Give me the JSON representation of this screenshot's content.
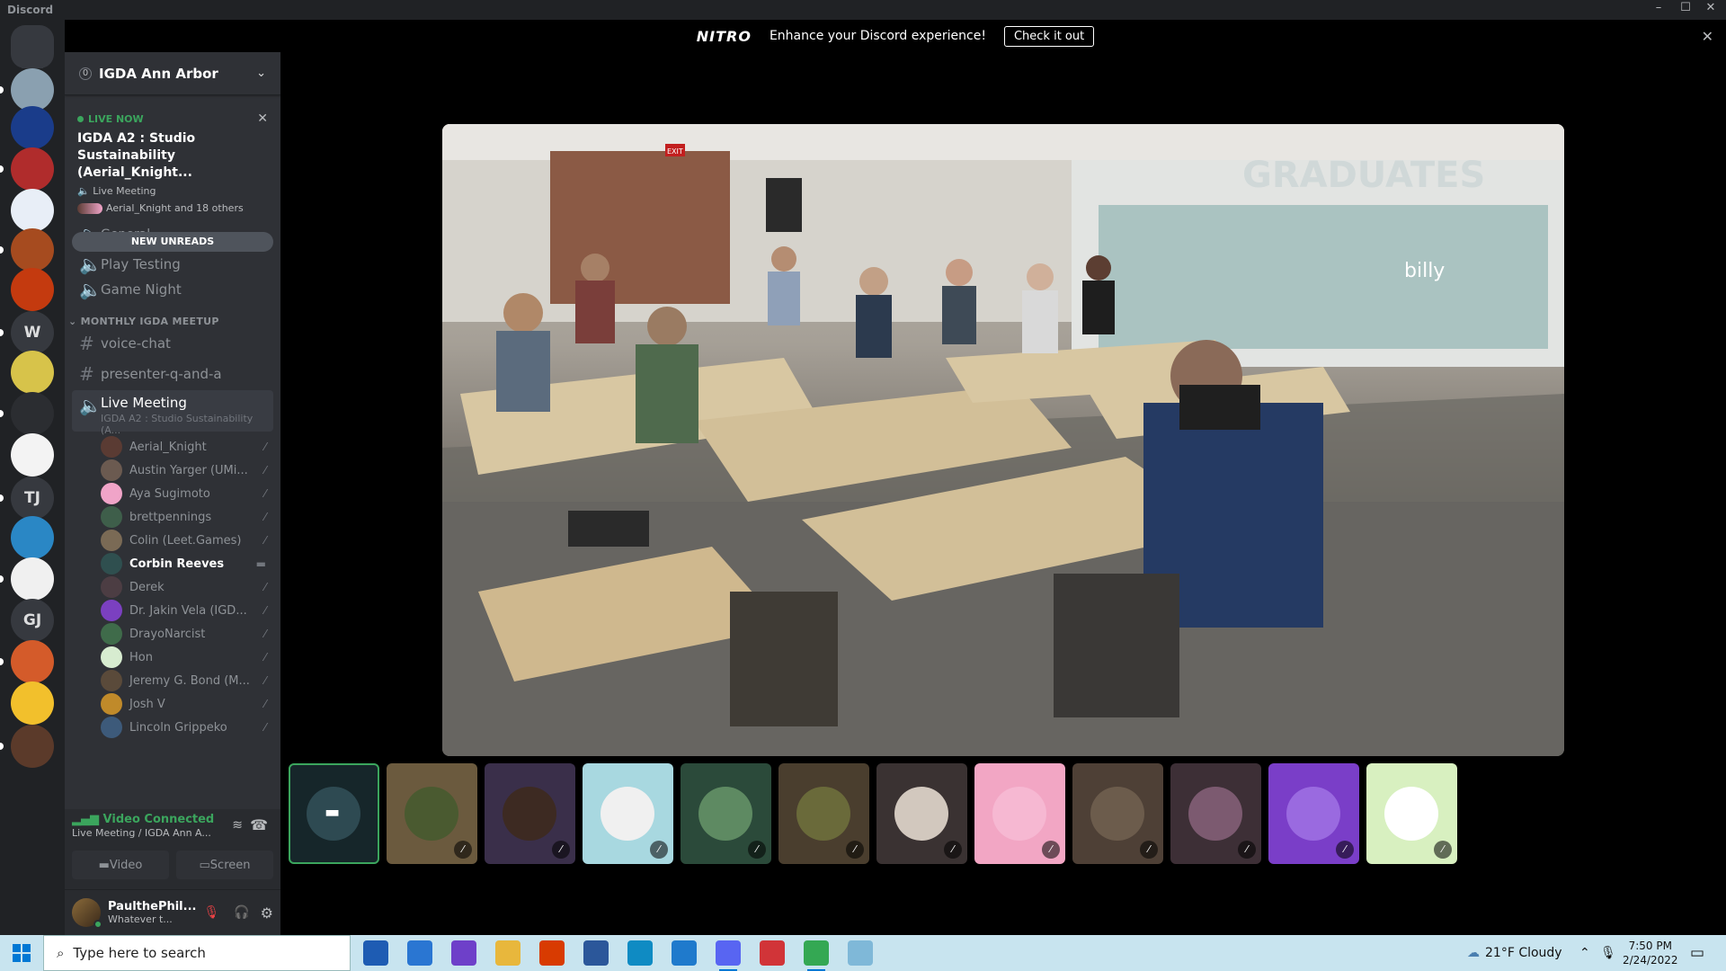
{
  "window": {
    "title": "Discord",
    "minimize": "–",
    "maximize": "☐",
    "close": "✕"
  },
  "nitro": {
    "logo": "NITRO",
    "message": "Enhance your Discord experience!",
    "cta": "Check it out",
    "close": "✕"
  },
  "guilds": [
    {
      "name": "home",
      "label": "",
      "color": "#36393f"
    },
    {
      "name": "server-1",
      "label": "",
      "color": "#8aa0b0"
    },
    {
      "name": "server-2",
      "label": "",
      "color": "#1a3c8a"
    },
    {
      "name": "server-3",
      "label": "",
      "color": "#b02c2c"
    },
    {
      "name": "server-4",
      "label": "",
      "color": "#e8eef7"
    },
    {
      "name": "server-5",
      "label": "",
      "color": "#a64b1f"
    },
    {
      "name": "server-6",
      "label": "",
      "color": "#c43a0f"
    },
    {
      "name": "server-w",
      "label": "W",
      "color": "#36393f"
    },
    {
      "name": "server-8",
      "label": "",
      "color": "#d7c34a"
    },
    {
      "name": "server-9",
      "label": "",
      "color": "#2b2d31"
    },
    {
      "name": "server-10",
      "label": "",
      "color": "#f3f3f3"
    },
    {
      "name": "server-tj",
      "label": "TJ",
      "color": "#36393f"
    },
    {
      "name": "server-12",
      "label": "",
      "color": "#2a87c5"
    },
    {
      "name": "server-13",
      "label": "",
      "color": "#f0f0f0"
    },
    {
      "name": "server-gj",
      "label": "GJ",
      "color": "#36393f"
    },
    {
      "name": "server-15",
      "label": "",
      "color": "#d45b2a"
    },
    {
      "name": "server-16",
      "label": "",
      "color": "#f2c02c"
    },
    {
      "name": "server-17",
      "label": "",
      "color": "#5b3a2a"
    }
  ],
  "server": {
    "name": "IGDA Ann Arbor",
    "badge": "0"
  },
  "event": {
    "live": "LIVE NOW",
    "title": "IGDA A2 : Studio Sustainability (Aerial_Knight...",
    "location": "Live Meeting",
    "attendees": "Aerial_Knight and 18 others"
  },
  "new_unreads": "NEW UNREADS",
  "channels_top": [
    {
      "label": "General",
      "type": "voice"
    },
    {
      "label": "Play Testing",
      "type": "voice"
    },
    {
      "label": "Game Night",
      "type": "voice"
    }
  ],
  "category": "MONTHLY IGDA MEETUP",
  "channels_cat": [
    {
      "label": "voice-chat",
      "type": "text"
    },
    {
      "label": "presenter-q-and-a",
      "type": "text"
    }
  ],
  "live_channel": {
    "label": "Live Meeting",
    "sub": "IGDA A2 : Studio Sustainability (A..."
  },
  "voice_users": [
    {
      "name": "Aerial_Knight",
      "color": "#5a3b33",
      "icon": "mute-icon",
      "bold": false
    },
    {
      "name": "Austin Yarger (UMi...",
      "color": "#6b5a50",
      "icon": "mute-icon",
      "bold": false
    },
    {
      "name": "Aya Sugimoto",
      "color": "#f0a4c8",
      "icon": "mute-icon",
      "bold": false
    },
    {
      "name": "brettpennings",
      "color": "#3e5e4a",
      "icon": "mute-icon",
      "bold": false
    },
    {
      "name": "Colin (Leet.Games)",
      "color": "#7a6a55",
      "icon": "mute-icon",
      "bold": false
    },
    {
      "name": "Corbin Reeves",
      "color": "#2f4f4f",
      "icon": "camera-icon",
      "bold": true
    },
    {
      "name": "Derek",
      "color": "#4c3d43",
      "icon": "mute-icon",
      "bold": false
    },
    {
      "name": "Dr. Jakin Vela (IGD...",
      "color": "#7b40c0",
      "icon": "mute-icon",
      "bold": false
    },
    {
      "name": "DrayoNarcist",
      "color": "#3f6b4a",
      "icon": "mute-icon",
      "bold": false
    },
    {
      "name": "Hon",
      "color": "#d7ecd0",
      "icon": "mute-icon",
      "bold": false
    },
    {
      "name": "Jeremy G. Bond (M...",
      "color": "#5a4a3a",
      "icon": "mute-icon",
      "bold": false
    },
    {
      "name": "Josh V",
      "color": "#c08a2a",
      "icon": "mute-icon",
      "bold": false
    },
    {
      "name": "Lincoln Grippeko",
      "color": "#3d5a7a",
      "icon": "mute-icon",
      "bold": false
    }
  ],
  "voice_panel": {
    "status": "Video Connected",
    "location": "Live Meeting / IGDA Ann A...",
    "video": "Video",
    "screen": "Screen"
  },
  "user_panel": {
    "name": "PaulthePhil...",
    "status": "Whatever t..."
  },
  "tiles": [
    {
      "name": "tile-1",
      "bg": "#16262a",
      "av": "#2e4a52",
      "label": "",
      "selected": true
    },
    {
      "name": "tile-2",
      "bg": "#6b5a3e",
      "av": "#4a5a30"
    },
    {
      "name": "tile-3",
      "bg": "#3a2f4a",
      "av": "#3d2a22"
    },
    {
      "name": "tile-4",
      "bg": "#a8d8e0",
      "av": "#f0f0f0"
    },
    {
      "name": "tile-5",
      "bg": "#2b4a3a",
      "av": "#5e8a62"
    },
    {
      "name": "tile-6",
      "bg": "#4a3e2e",
      "av": "#6a6a3a"
    },
    {
      "name": "tile-7",
      "bg": "#3a3232",
      "av": "#d2c8be"
    },
    {
      "name": "tile-8",
      "bg": "#f2a6c4",
      "av": "#f6b8d2"
    },
    {
      "name": "tile-9",
      "bg": "#4e4036",
      "av": "#6c5c4c"
    },
    {
      "name": "tile-10",
      "bg": "#3d2f36",
      "av": "#7c5a70"
    },
    {
      "name": "tile-11",
      "bg": "#7a3ec8",
      "av": "#9a6ae0"
    },
    {
      "name": "tile-12",
      "bg": "#d8f0c0",
      "av": "#ffffff"
    }
  ],
  "video": {
    "sign": "GRADUATES",
    "exit": "EXIT",
    "sign2": "billy"
  },
  "taskbar": {
    "search_placeholder": "Type here to search",
    "weather": "21°F  Cloudy",
    "time": "7:50 PM",
    "date": "2/24/2022",
    "apps": [
      {
        "name": "store",
        "color": "#1e5cb3"
      },
      {
        "name": "mail",
        "color": "#2a76d2"
      },
      {
        "name": "github",
        "color": "#6e40c9"
      },
      {
        "name": "files",
        "color": "#e8b73c"
      },
      {
        "name": "office",
        "color": "#d83b01"
      },
      {
        "name": "word",
        "color": "#2b579a"
      },
      {
        "name": "edge",
        "color": "#0f8bc3"
      },
      {
        "name": "vscode",
        "color": "#1f7acc"
      },
      {
        "name": "discord",
        "color": "#5865f2"
      },
      {
        "name": "clock",
        "color": "#d13438"
      },
      {
        "name": "chrome",
        "color": "#34a853"
      },
      {
        "name": "notes",
        "color": "#7fb8d8"
      }
    ]
  }
}
